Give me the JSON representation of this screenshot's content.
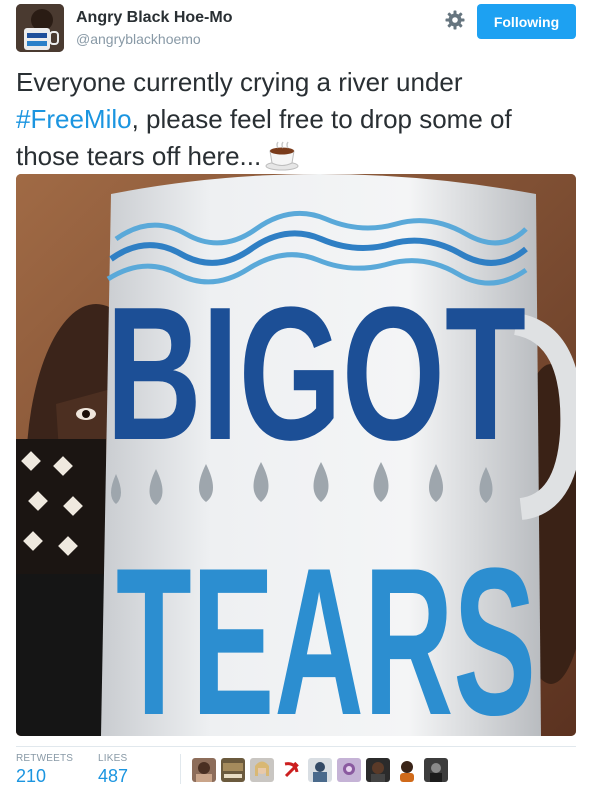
{
  "author": {
    "name": "Angry Black Hoe-Mo",
    "handle": "@angryblackhoemo",
    "avatar_icon": "user-avatar-mug-photo"
  },
  "actions": {
    "settings_icon": "gear-icon",
    "follow_label": "Following",
    "follow_color": "#1da1f2"
  },
  "tweet": {
    "line1": "Everyone currently crying a river under",
    "hashtag": "#FreeMilo",
    "line2_rest": ", please feel free to drop some of",
    "line3": "those tears off here...",
    "emoji": "hot-beverage-emoji",
    "hashtag_color": "#1b95e0"
  },
  "media": {
    "mug_text_top": "BIGOT",
    "mug_text_bottom": "TEARS"
  },
  "stats": {
    "retweets_label": "RETWEETS",
    "retweets_value": "210",
    "likes_label": "LIKES",
    "likes_value": "487"
  },
  "likers": [
    "liker-avatar-1",
    "liker-avatar-2",
    "liker-avatar-3",
    "liker-avatar-4",
    "liker-avatar-5",
    "liker-avatar-6",
    "liker-avatar-7",
    "liker-avatar-8",
    "liker-avatar-9"
  ]
}
